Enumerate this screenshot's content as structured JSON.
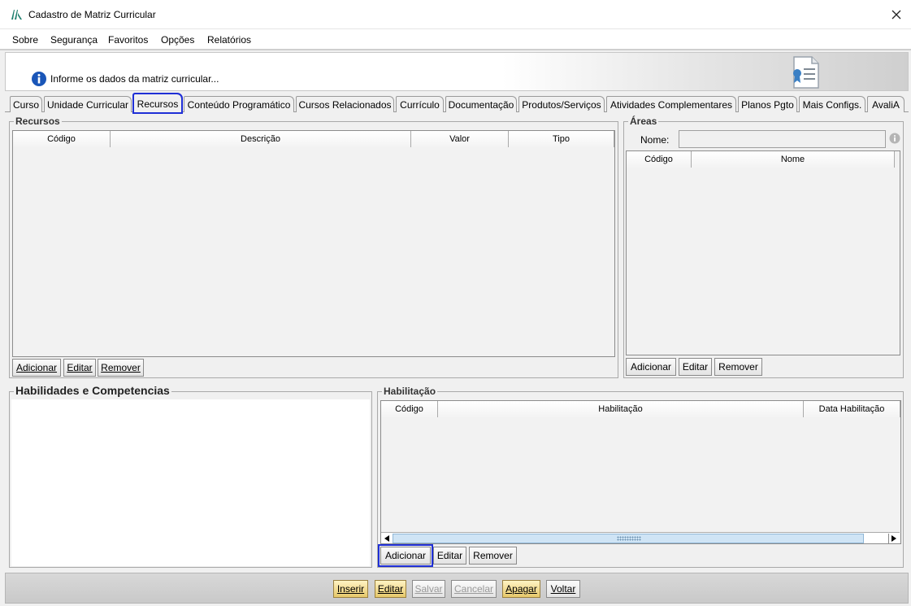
{
  "window": {
    "title": "Cadastro de Matriz Curricular",
    "logo_icon": "app-logo-icon",
    "close_icon": "close-icon"
  },
  "menu": [
    "Sobre",
    "Segurança",
    "Favoritos",
    "Opções",
    "Relatórios"
  ],
  "banner": {
    "text": "Informe os dados da matriz curricular...",
    "icon": "info-icon",
    "illustration": "certificate-icon"
  },
  "tabs": [
    "Curso",
    "Unidade Curricular",
    "Recursos",
    "Conteúdo Programático",
    "Cursos Relacionados",
    "Currículo",
    "Documentação",
    "Produtos/Serviços",
    "Atividades Complementares",
    "Planos Pgto",
    "Mais Configs.",
    "AvaliA"
  ],
  "active_tab": "Recursos",
  "recursos": {
    "title": "Recursos",
    "columns": [
      "Código",
      "Descrição",
      "Valor",
      "Tipo"
    ],
    "buttons": {
      "add": "Adicionar",
      "edit": "Editar",
      "remove": "Remover"
    }
  },
  "areas": {
    "title": "Áreas",
    "name_label": "Nome:",
    "name_value": "",
    "columns": [
      "Código",
      "Nome"
    ],
    "buttons": {
      "add": "Adicionar",
      "edit": "Editar",
      "remove": "Remover"
    }
  },
  "habilidades": {
    "title": "Habilidades e Competencias"
  },
  "habilitacao": {
    "title": "Habilitação",
    "columns": [
      "Código",
      "Habilitação",
      "Data Habilitação"
    ],
    "buttons": {
      "add": "Adicionar",
      "edit": "Editar",
      "remove": "Remover"
    }
  },
  "footer": {
    "insert": "Inserir",
    "edit": "Editar",
    "save": "Salvar",
    "cancel": "Cancelar",
    "delete": "Apagar",
    "back": "Voltar"
  },
  "colors": {
    "highlight": "#1f2fd6",
    "gold_button": "#e6c86a",
    "info_blue": "#1a56b8"
  }
}
